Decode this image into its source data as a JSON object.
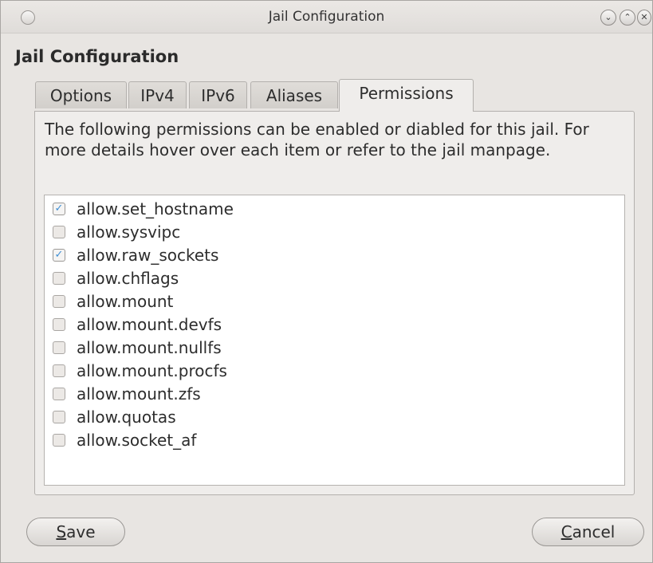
{
  "window": {
    "title": "Jail Configuration",
    "controls": {
      "minimize": "⌄",
      "maximize": "⌃",
      "close": "✕"
    }
  },
  "heading": "Jail Configuration",
  "tabs": [
    {
      "label": "Options"
    },
    {
      "label": "IPv4"
    },
    {
      "label": "IPv6"
    },
    {
      "label": "Aliases"
    },
    {
      "label": "Permissions",
      "active": true
    }
  ],
  "description": "The following permissions can be enabled or diabled for this jail. For more details hover over each item or refer to the jail manpage.",
  "permissions": [
    {
      "label": "allow.set_hostname",
      "checked": true
    },
    {
      "label": "allow.sysvipc",
      "checked": false
    },
    {
      "label": "allow.raw_sockets",
      "checked": true
    },
    {
      "label": "allow.chflags",
      "checked": false
    },
    {
      "label": "allow.mount",
      "checked": false
    },
    {
      "label": "allow.mount.devfs",
      "checked": false
    },
    {
      "label": "allow.mount.nullfs",
      "checked": false
    },
    {
      "label": "allow.mount.procfs",
      "checked": false
    },
    {
      "label": "allow.mount.zfs",
      "checked": false
    },
    {
      "label": "allow.quotas",
      "checked": false
    },
    {
      "label": "allow.socket_af",
      "checked": false
    }
  ],
  "buttons": {
    "save": {
      "mnemonic": "S",
      "rest": "ave"
    },
    "cancel": {
      "mnemonic": "C",
      "rest": "ancel"
    }
  },
  "colors": {
    "check_accent": "#3f8fd4"
  }
}
